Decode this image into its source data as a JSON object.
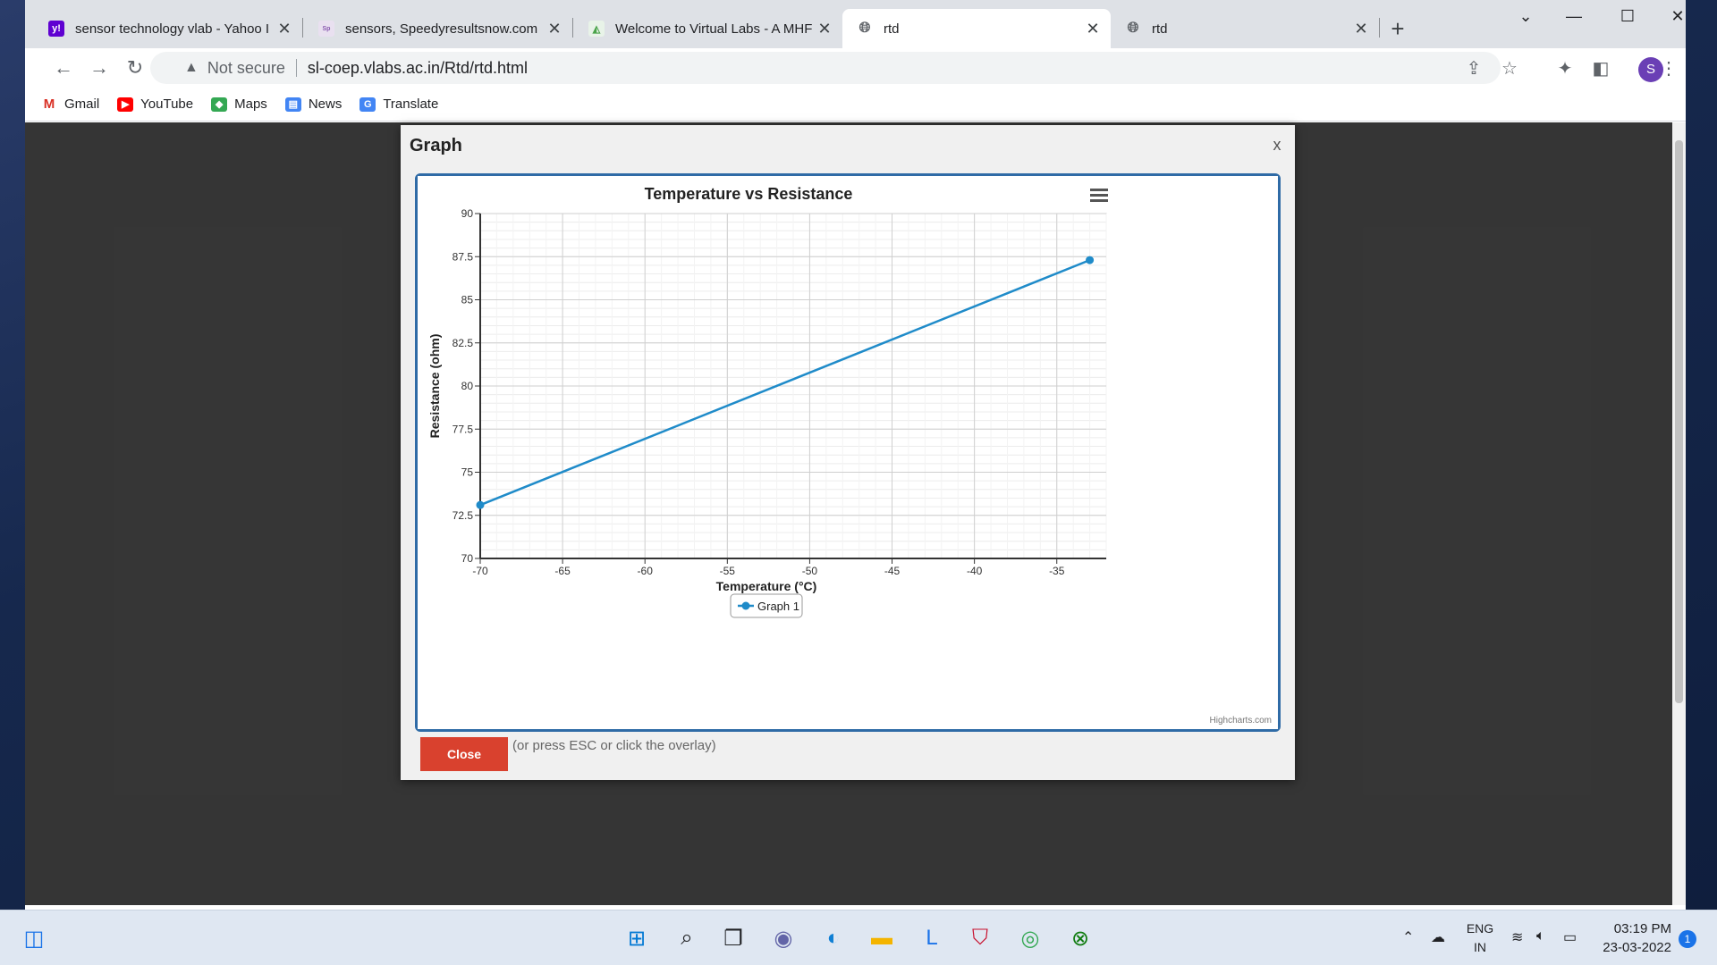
{
  "browser": {
    "tabs": [
      {
        "title": "sensor technology vlab - Yahoo I",
        "favicon": "yahoo-icon",
        "color": "#5f01d1"
      },
      {
        "title": "sensors, Speedyresultsnow.com",
        "favicon": "speedy-icon",
        "color": "#b07dd0"
      },
      {
        "title": "Welcome to Virtual Labs - A MHF",
        "favicon": "vlabs-icon",
        "color": "#4aa34a"
      },
      {
        "title": "rtd",
        "favicon": "globe-icon",
        "color": "#5f6368"
      },
      {
        "title": "rtd",
        "favicon": "globe-icon",
        "color": "#5f6368"
      }
    ],
    "active_tab": 3,
    "address": {
      "security": "Not secure",
      "url": "sl-coep.vlabs.ac.in/Rtd/rtd.html"
    },
    "profile_initial": "S",
    "bookmarks": [
      {
        "label": "Gmail",
        "icon": "gmail-icon",
        "color": "#d93025"
      },
      {
        "label": "YouTube",
        "icon": "youtube-icon",
        "color": "#ff0000"
      },
      {
        "label": "Maps",
        "icon": "maps-icon",
        "color": "#34a853"
      },
      {
        "label": "News",
        "icon": "news-icon",
        "color": "#4285f4"
      },
      {
        "label": "Translate",
        "icon": "translate-icon",
        "color": "#4285f4"
      }
    ]
  },
  "modal": {
    "title": "Graph",
    "close_x": "x",
    "close_button": "Close",
    "hint": "(or press ESC or click the overlay)"
  },
  "chart_data": {
    "type": "line",
    "title": "Temperature vs Resistance",
    "xlabel": "Temperature (°C)",
    "ylabel": "Resistance (ohm)",
    "xlim": [
      -70,
      -32
    ],
    "ylim": [
      70,
      90
    ],
    "x_ticks": [
      "-70",
      "-65",
      "-60",
      "-55",
      "-50",
      "-45",
      "-40",
      "-35"
    ],
    "y_ticks": [
      "90",
      "87.5",
      "85",
      "82.5",
      "80",
      "77.5",
      "75",
      "72.5",
      "70"
    ],
    "series": [
      {
        "name": "Graph 1",
        "color": "#1f8bc9",
        "points": [
          [
            -70,
            73.1
          ],
          [
            -33,
            87.3
          ]
        ]
      }
    ],
    "grid": true,
    "legend": "bottom-center",
    "credit": "Highcharts.com"
  },
  "taskbar": {
    "language": {
      "line1": "ENG",
      "line2": "IN"
    },
    "time": "03:19 PM",
    "date": "23-03-2022",
    "notifications": "1"
  }
}
